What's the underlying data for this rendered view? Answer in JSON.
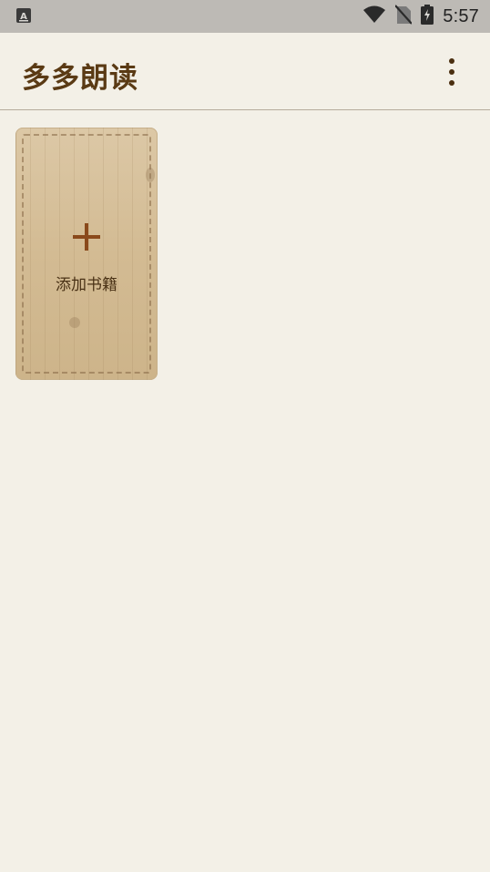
{
  "status_bar": {
    "time": "5:57",
    "icons": [
      "keyboard-a-icon",
      "wifi-icon",
      "no-sim-icon",
      "battery-charging-icon"
    ]
  },
  "app_bar": {
    "title": "多多朗读",
    "menu_icon": "more-vertical-icon"
  },
  "bookshelf": {
    "add_book_label": "添加书籍",
    "add_icon": "plus-icon"
  },
  "colors": {
    "background": "#f3f0e7",
    "status_bar": "#bdbab5",
    "title": "#5a3a14",
    "card": "#d3bb93",
    "plus": "#8a4a1c"
  }
}
